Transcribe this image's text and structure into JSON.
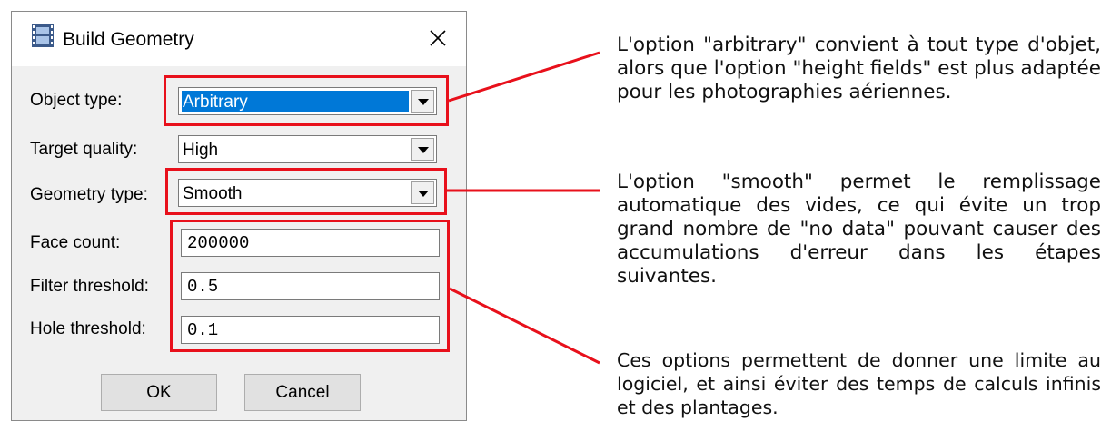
{
  "dialog": {
    "title": "Build Geometry",
    "icons": {
      "app": "film-strip-icon",
      "close": "close-icon"
    },
    "fields": {
      "object_type": {
        "label": "Object type:",
        "value": "Arbitrary"
      },
      "target_quality": {
        "label": "Target quality:",
        "value": "High"
      },
      "geometry_type": {
        "label": "Geometry type:",
        "value": "Smooth"
      },
      "face_count": {
        "label": "Face count:",
        "value": "200000"
      },
      "filter_threshold": {
        "label": "Filter threshold:",
        "value": "0.5"
      },
      "hole_threshold": {
        "label": "Hole threshold:",
        "value": "0.1"
      }
    },
    "buttons": {
      "ok": "OK",
      "cancel": "Cancel"
    }
  },
  "annotations": {
    "object_type_note": "L'option \"arbitrary\" convient à tout type d'objet, alors que l'option \"height fields\" est plus adaptée pour les photographies aériennes.",
    "geometry_type_note": "L'option \"smooth\" permet le remplissage automatique des vides, ce qui évite un trop grand nombre de \"no data\" pouvant causer des accumulations d'erreur dans les étapes suivantes.",
    "thresholds_note": "Ces options permettent de donner une limite au logiciel, et ainsi éviter des temps de calculs infinis et des plantages."
  },
  "colors": {
    "highlight": "#e8101b",
    "selection": "#0078d7",
    "dialog_bg": "#f0f0f0"
  }
}
